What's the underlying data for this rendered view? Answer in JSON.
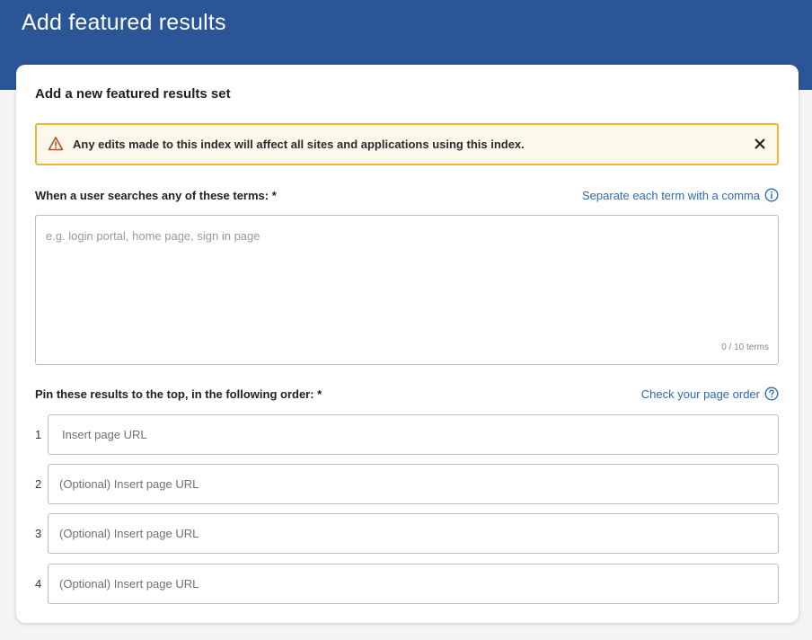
{
  "header": {
    "title": "Add featured results"
  },
  "card": {
    "title": "Add a new featured results set",
    "alert": {
      "icon": "warning-icon",
      "message": "Any edits made to this index will affect all sites and applications using this index.",
      "close_icon": "close-icon"
    },
    "terms": {
      "label": "When a user searches any of these terms: *",
      "help_text": "Separate each term with a comma",
      "help_icon": "info-icon",
      "placeholder": "e.g. login portal, home page, sign in page",
      "value": "",
      "counter": "0 / 10 terms"
    },
    "pins": {
      "label": "Pin these results to the top, in the following order: *",
      "help_text": "Check your page order",
      "help_icon": "question-icon",
      "rows": [
        {
          "number": "1",
          "placeholder": "Insert page URL",
          "value": ""
        },
        {
          "number": "2",
          "placeholder": "(Optional) Insert page URL",
          "value": ""
        },
        {
          "number": "3",
          "placeholder": "(Optional) Insert page URL",
          "value": ""
        },
        {
          "number": "4",
          "placeholder": "(Optional) Insert page URL",
          "value": ""
        }
      ]
    }
  },
  "colors": {
    "header_bg": "#2a5597",
    "link": "#2e6ab6",
    "alert_border": "#f0b43c",
    "alert_bg": "#fdf8ec"
  }
}
